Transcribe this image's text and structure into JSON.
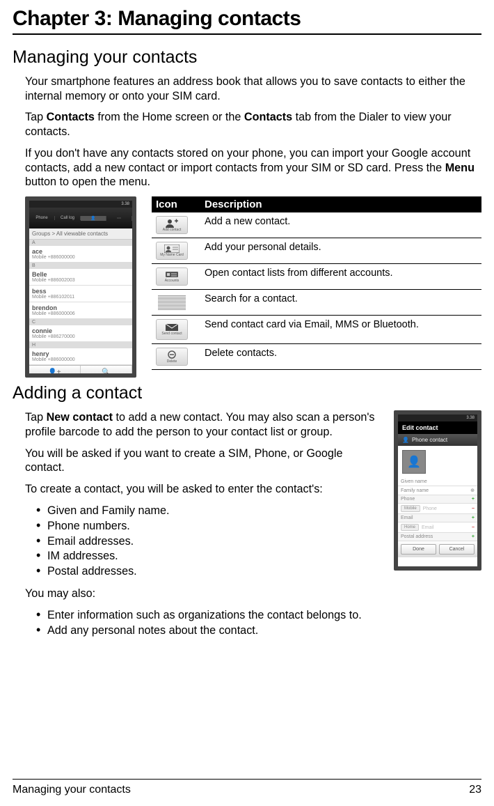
{
  "chapterTitle": "Chapter 3: Managing contacts",
  "section1": {
    "title": "Managing your contacts",
    "p1": "Your smartphone features an address book that allows you to save contacts to either the internal memory or onto your SIM card.",
    "p2a": "Tap ",
    "p2b": "Contacts",
    "p2c": " from the Home screen or the ",
    "p2d": "Contacts",
    "p2e": " tab from the Dialer to view your contacts.",
    "p3a": "If you don't have any contacts stored on your phone, you can import your Google account contacts, add a new contact or import contacts from your SIM or SD card. Press the ",
    "p3b": "Menu",
    "p3c": " button to open the menu."
  },
  "tableHeader": {
    "c1": "Icon",
    "c2": "Description"
  },
  "tableRows": [
    {
      "desc": "Add a new contact."
    },
    {
      "desc": "Add your personal details."
    },
    {
      "desc": "Open contact lists from different accounts."
    },
    {
      "desc": "Search for a contact."
    },
    {
      "desc": "Send contact card via Email, MMS or Bluetooth."
    },
    {
      "desc": "Delete contacts."
    }
  ],
  "sendContactLabel": "Send contact",
  "screenshot1": {
    "time": "3.38",
    "tabs": [
      "Phone",
      "Call log",
      "",
      "Contacts"
    ],
    "groups": "Groups  > All viewable contacts",
    "letterA": "A",
    "letterB": "B",
    "letterC": "C",
    "letterH": "H",
    "contacts": [
      {
        "n": "ace",
        "m": "Mobile +886000000"
      },
      {
        "n": "Belle",
        "m": "Mobile +886002003"
      },
      {
        "n": "bess",
        "m": "Mobile +886102011"
      },
      {
        "n": "brendon",
        "m": "Mobile +886000006"
      },
      {
        "n": "connie",
        "m": "Mobile +886270000"
      },
      {
        "n": "henry",
        "m": "Mobile +886000000"
      }
    ]
  },
  "section2": {
    "title": "Adding a contact",
    "p1a": "Tap ",
    "p1b": "New contact",
    "p1c": " to add a new contact. You may also scan a person's profile barcode to add the person to your contact list or group.",
    "p2": "You will be asked if you want to create a SIM, Phone, or Google contact.",
    "p3": "To create a contact, you will be asked to enter the contact's:",
    "bullets1": [
      "Given and Family name.",
      "Phone numbers.",
      "Email addresses.",
      "IM addresses.",
      "Postal addresses."
    ],
    "p4": "You may also:",
    "bullets2": [
      "Enter information such as organizations the contact belongs to.",
      "Add any personal notes about the contact."
    ]
  },
  "screenshot2": {
    "time": "3.38",
    "title": "Edit contact",
    "subtitle": "Phone contact",
    "fields": [
      "Given name",
      "Family name",
      "Phone",
      "Email",
      "Postal address"
    ],
    "done": "Done",
    "cancel": "Cancel"
  },
  "footer": {
    "left": "Managing your contacts",
    "right": "23"
  }
}
